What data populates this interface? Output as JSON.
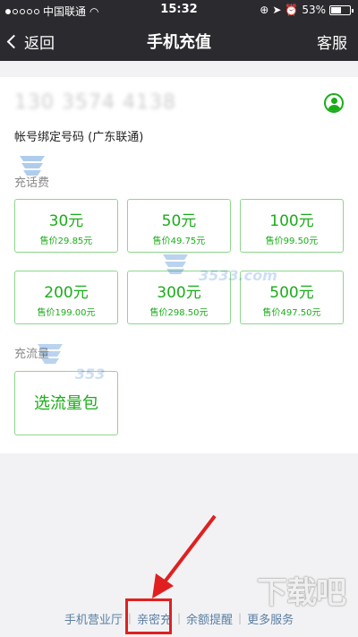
{
  "status_bar": {
    "carrier": "中国联通",
    "time": "15:32",
    "battery": "53%",
    "battery_level": 0.53
  },
  "nav": {
    "back_label": "返回",
    "title": "手机充值",
    "right_label": "客服"
  },
  "account": {
    "phone": "130 3574 4138",
    "binding": "帐号绑定号码 (广东联通)"
  },
  "recharge": {
    "label": "充话费",
    "options": [
      {
        "amount": "30元",
        "price": "售价29.85元"
      },
      {
        "amount": "50元",
        "price": "售价49.75元"
      },
      {
        "amount": "100元",
        "price": "售价99.50元"
      },
      {
        "amount": "200元",
        "price": "售价199.00元"
      },
      {
        "amount": "300元",
        "price": "售价298.50元"
      },
      {
        "amount": "500元",
        "price": "售价497.50元"
      }
    ]
  },
  "data_plan": {
    "label": "充流量",
    "select_label": "选流量包"
  },
  "watermarks": {
    "domain": "3533.com",
    "short": "353",
    "site": "下载吧"
  },
  "bottom_links": [
    "手机营业厅",
    "亲密充",
    "余额提醒",
    "更多服务"
  ],
  "colors": {
    "accent": "#1aad19",
    "bar": "#2b2b2f",
    "highlight": "#e02020"
  }
}
